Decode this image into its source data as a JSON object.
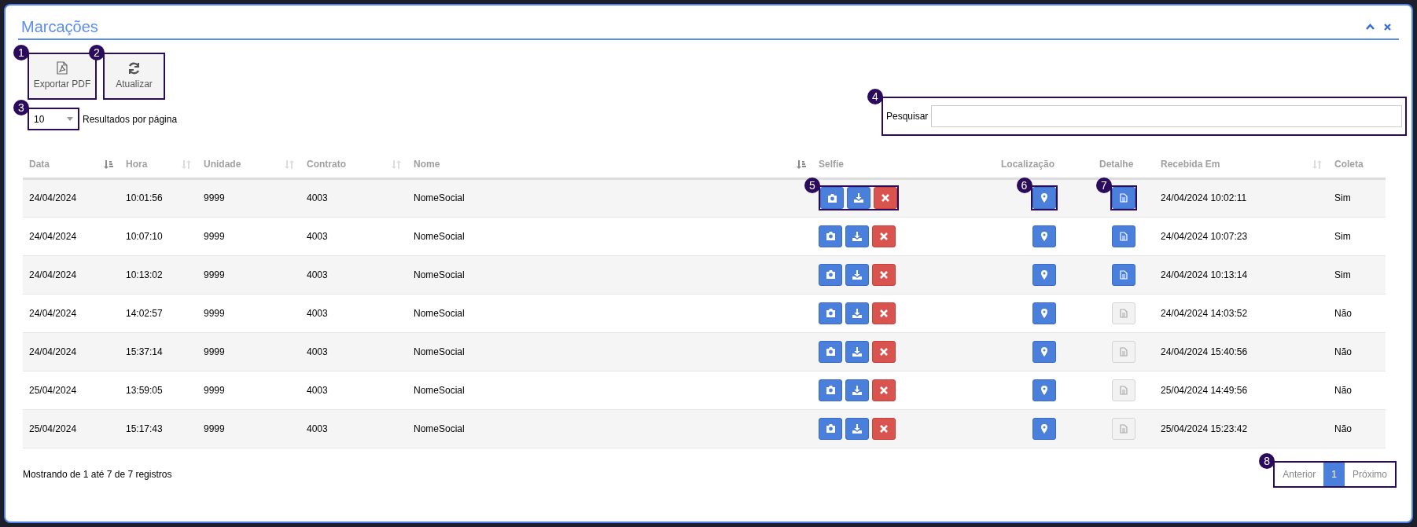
{
  "panel": {
    "title": "Marcações"
  },
  "toolbar": [
    {
      "kind": "pdf",
      "label": "Exportar PDF",
      "callout": "1"
    },
    {
      "kind": "refresh",
      "label": "Atualizar",
      "callout": "2"
    }
  ],
  "page_size": {
    "value": "10",
    "label": "Resultados por página",
    "callout": "3"
  },
  "search": {
    "label": "Pesquisar",
    "callout": "4"
  },
  "table": {
    "columns": [
      {
        "label": "Data",
        "sorted": true
      },
      {
        "label": "Hora",
        "sorted": false
      },
      {
        "label": "Unidade",
        "sorted": false
      },
      {
        "label": "Contrato",
        "sorted": false
      },
      {
        "label": "Nome",
        "sorted": true
      },
      {
        "label": "Selfie"
      },
      {
        "label": "Localização"
      },
      {
        "label": "Detalhe"
      },
      {
        "label": "Recebida Em",
        "sorted": false
      },
      {
        "label": "Coleta"
      }
    ],
    "callouts": {
      "selfie": "5",
      "location": "6",
      "detail": "7"
    },
    "rows": [
      {
        "data": "24/04/2024",
        "hora": "10:01:56",
        "unidade": "9999",
        "contrato": "4003",
        "nome": "NomeSocial",
        "detail_enabled": true,
        "recebida": "24/04/2024 10:02:11",
        "coleta": "Sim"
      },
      {
        "data": "24/04/2024",
        "hora": "10:07:10",
        "unidade": "9999",
        "contrato": "4003",
        "nome": "NomeSocial",
        "detail_enabled": true,
        "recebida": "24/04/2024 10:07:23",
        "coleta": "Sim"
      },
      {
        "data": "24/04/2024",
        "hora": "10:13:02",
        "unidade": "9999",
        "contrato": "4003",
        "nome": "NomeSocial",
        "detail_enabled": true,
        "recebida": "24/04/2024 10:13:14",
        "coleta": "Sim"
      },
      {
        "data": "24/04/2024",
        "hora": "14:02:57",
        "unidade": "9999",
        "contrato": "4003",
        "nome": "NomeSocial",
        "detail_enabled": false,
        "recebida": "24/04/2024 14:03:52",
        "coleta": "Não"
      },
      {
        "data": "24/04/2024",
        "hora": "15:37:14",
        "unidade": "9999",
        "contrato": "4003",
        "nome": "NomeSocial",
        "detail_enabled": false,
        "recebida": "24/04/2024 15:40:56",
        "coleta": "Não"
      },
      {
        "data": "25/04/2024",
        "hora": "13:59:05",
        "unidade": "9999",
        "contrato": "4003",
        "nome": "NomeSocial",
        "detail_enabled": false,
        "recebida": "25/04/2024 14:49:56",
        "coleta": "Não"
      },
      {
        "data": "25/04/2024",
        "hora": "15:17:43",
        "unidade": "9999",
        "contrato": "4003",
        "nome": "NomeSocial",
        "detail_enabled": false,
        "recebida": "25/04/2024 15:23:42",
        "coleta": "Não"
      }
    ]
  },
  "footer": {
    "summary": "Mostrando de 1 até 7 de 7 registros",
    "pagination": {
      "callout": "8",
      "items": [
        {
          "label": "Anterior",
          "selected": false
        },
        {
          "label": "1",
          "selected": true
        },
        {
          "label": "Próximo",
          "selected": false
        }
      ]
    }
  }
}
